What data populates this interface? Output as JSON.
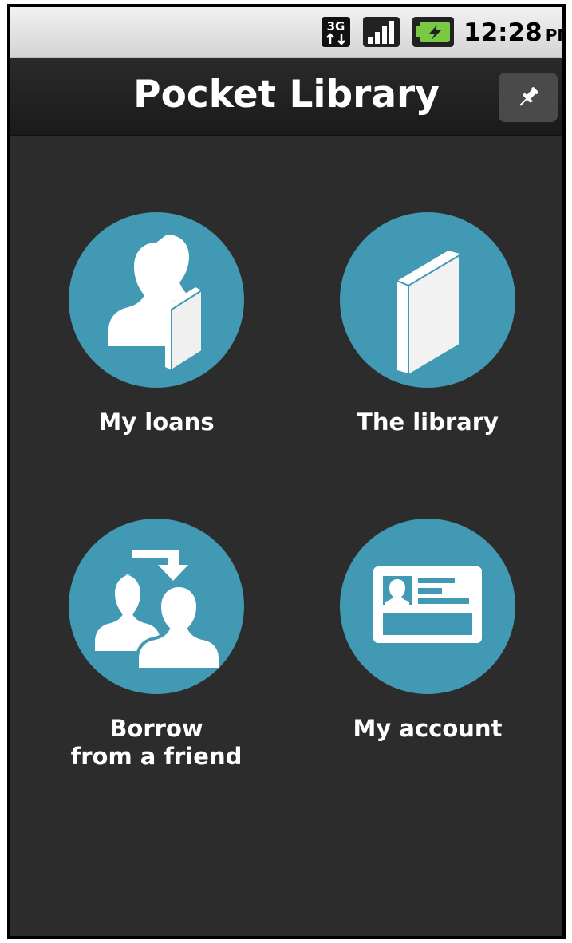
{
  "status_bar": {
    "network": "3G",
    "network_icon": "3g-network-icon",
    "signal_icon": "signal-strength-icon",
    "battery_icon": "battery-charging-icon",
    "time": "12:28",
    "ampm": "PM"
  },
  "app_bar": {
    "title": "Pocket Library",
    "pin_icon": "pin-icon"
  },
  "menu": {
    "accent_color": "#4199b3",
    "background_color": "#2c2c2c",
    "items": [
      {
        "label": "My loans",
        "icon": "user-with-book-icon"
      },
      {
        "label": "The library",
        "icon": "book-icon"
      },
      {
        "label": "Borrow\nfrom a friend",
        "icon": "users-transfer-icon"
      },
      {
        "label": "My account",
        "icon": "id-card-icon"
      }
    ]
  }
}
